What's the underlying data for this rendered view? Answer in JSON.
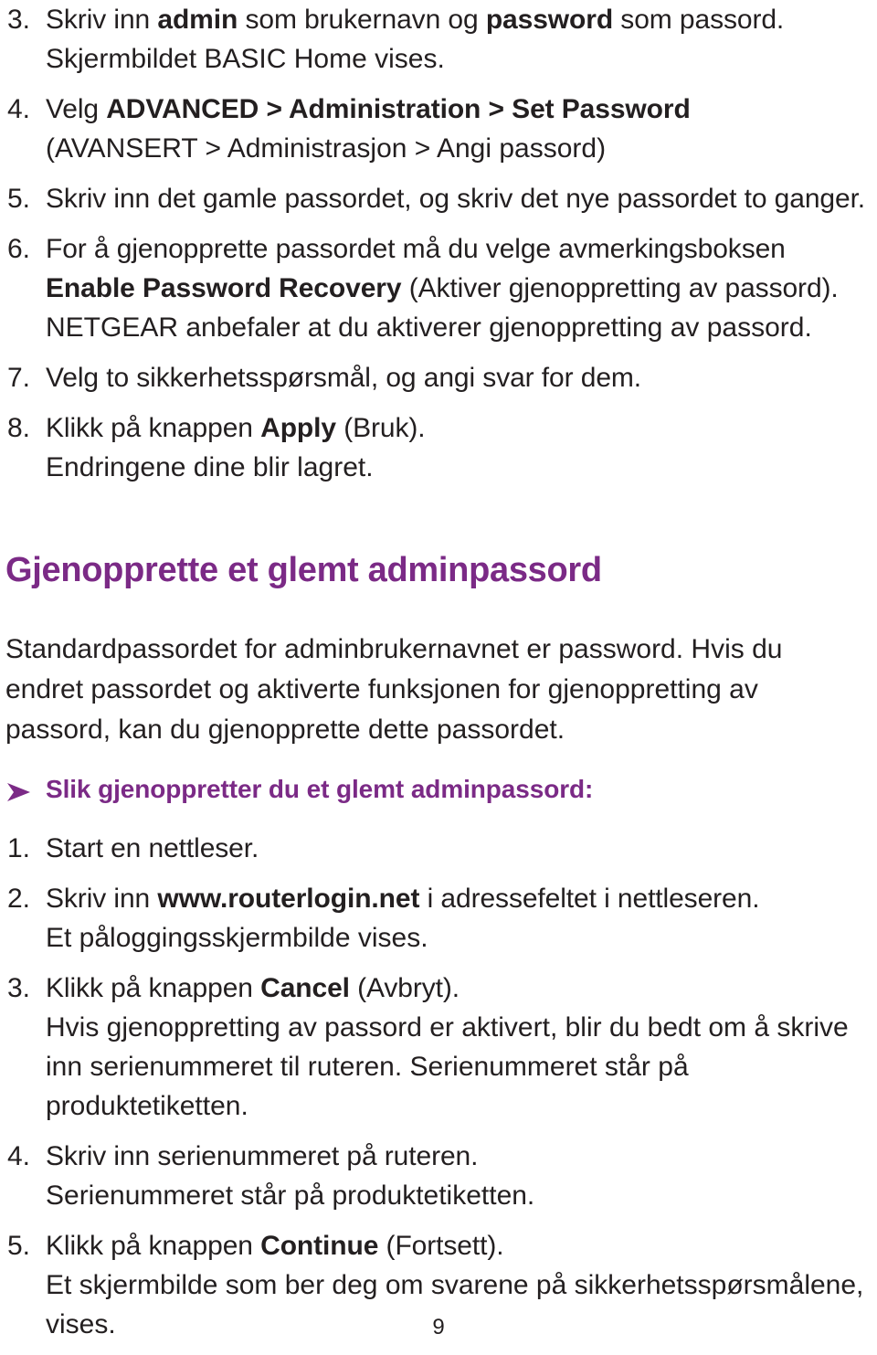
{
  "document": {
    "language": "Norwegian",
    "page_number": "9",
    "accent_color": "#7b2a86",
    "text_color": "#231f20",
    "background_color": "#ffffff"
  },
  "steps_top": [
    {
      "number": "3.",
      "segments": [
        {
          "text": "Skriv inn ",
          "bold": false
        },
        {
          "text": "admin",
          "bold": true
        },
        {
          "text": " som brukernavn og ",
          "bold": false
        },
        {
          "text": "password",
          "bold": true
        },
        {
          "text": " som passord.",
          "bold": false
        }
      ],
      "continuation": [
        "Skjermbildet BASIC Home vises."
      ]
    },
    {
      "number": "4.",
      "segments": [
        {
          "text": "Velg ",
          "bold": false
        },
        {
          "text": "ADVANCED > Administration > Set Password",
          "bold": true
        }
      ],
      "continuation": [
        "(AVANSERT > Administrasjon > Angi passord)"
      ]
    },
    {
      "number": "5.",
      "segments": [
        {
          "text": "Skriv inn det gamle passordet, og skriv det nye passordet to ganger.",
          "bold": false
        }
      ],
      "continuation": []
    },
    {
      "number": "6.",
      "segments": [
        {
          "text": "For å gjenopprette passordet må du velge avmerkingsboksen ",
          "bold": false
        },
        {
          "text": "Enable Password Recovery",
          "bold": true
        },
        {
          "text": " (Aktiver gjenoppretting av passord).",
          "bold": false
        }
      ],
      "continuation": [
        "NETGEAR anbefaler at du aktiverer gjenoppretting av passord."
      ]
    },
    {
      "number": "7.",
      "segments": [
        {
          "text": "Velg to sikkerhetsspørsmål, og angi svar for dem.",
          "bold": false
        }
      ],
      "continuation": []
    },
    {
      "number": "8.",
      "segments": [
        {
          "text": "Klikk på knappen ",
          "bold": false
        },
        {
          "text": "Apply",
          "bold": true
        },
        {
          "text": " (Bruk).",
          "bold": false
        }
      ],
      "continuation": [
        "Endringene dine blir lagret."
      ]
    }
  ],
  "section": {
    "heading": "Gjenopprette et glemt adminpassord",
    "intro": "Standardpassordet for adminbrukernavnet er password. Hvis du endret passordet og aktiverte funksjonen for gjenoppretting av passord, kan du gjenopprette dette passordet.",
    "subheading": "Slik gjenoppretter du et glemt adminpassord:",
    "subheading_bullet": "arrow-bullet-icon"
  },
  "steps_bottom": [
    {
      "number": "1.",
      "segments": [
        {
          "text": "Start en nettleser.",
          "bold": false
        }
      ],
      "continuation": []
    },
    {
      "number": "2.",
      "segments": [
        {
          "text": "Skriv inn ",
          "bold": false
        },
        {
          "text": "www.routerlogin.net",
          "bold": true
        },
        {
          "text": " i adressefeltet i nettleseren.",
          "bold": false
        }
      ],
      "continuation": [
        "Et påloggingsskjermbilde vises."
      ]
    },
    {
      "number": "3.",
      "segments": [
        {
          "text": "Klikk på knappen ",
          "bold": false
        },
        {
          "text": "Cancel",
          "bold": true
        },
        {
          "text": " (Avbryt).",
          "bold": false
        }
      ],
      "continuation": [
        "Hvis gjenoppretting av passord er aktivert, blir du bedt om å skrive inn serienummeret til ruteren. Serienummeret står på produktetiketten."
      ]
    },
    {
      "number": "4.",
      "segments": [
        {
          "text": "Skriv inn serienummeret på ruteren.",
          "bold": false
        }
      ],
      "continuation": [
        "Serienummeret står på produktetiketten."
      ]
    },
    {
      "number": "5.",
      "segments": [
        {
          "text": "Klikk på knappen ",
          "bold": false
        },
        {
          "text": "Continue",
          "bold": true
        },
        {
          "text": " (Fortsett).",
          "bold": false
        }
      ],
      "continuation": [
        "Et skjermbilde som ber deg om svarene på sikkerhetsspørsmålene, vises."
      ]
    }
  ],
  "footer": {
    "page_label": "9"
  }
}
